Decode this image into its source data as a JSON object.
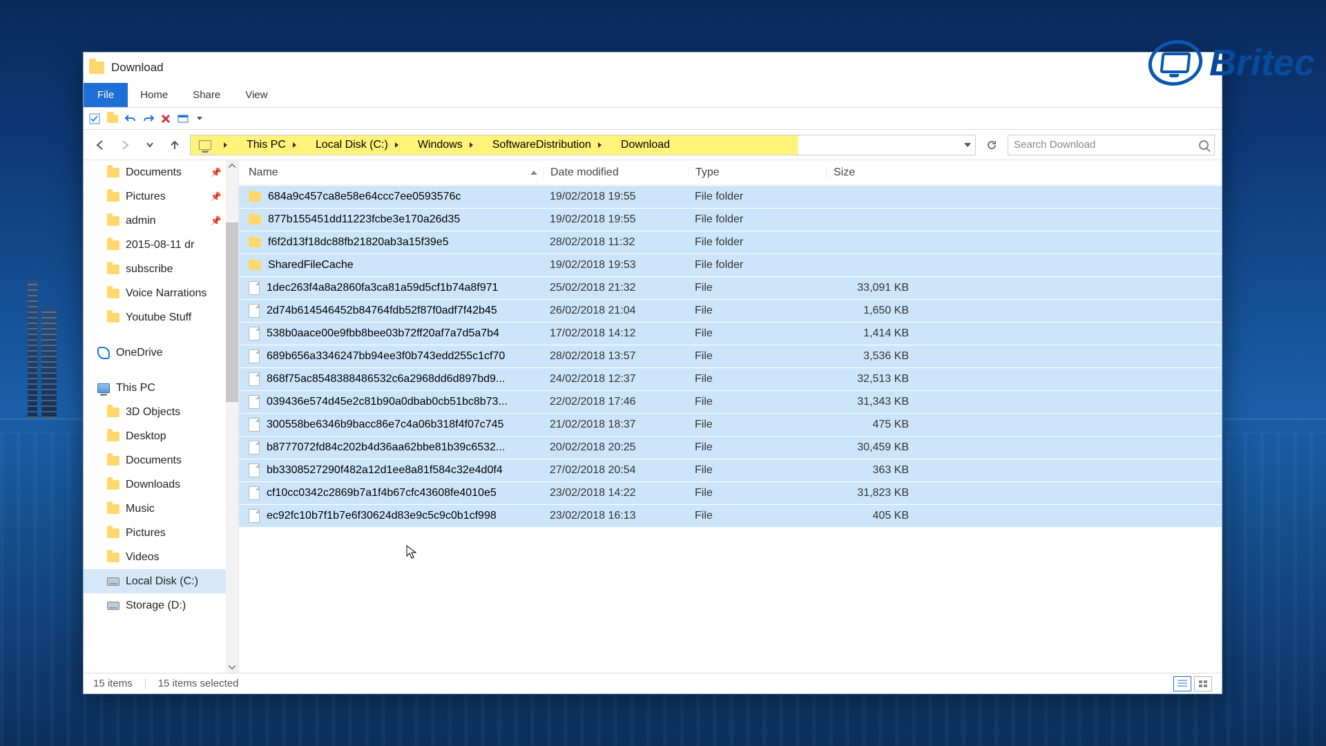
{
  "window": {
    "title": "Download"
  },
  "ribbon": {
    "file": "File",
    "home": "Home",
    "share": "Share",
    "view": "View"
  },
  "breadcrumb": {
    "root": "This PC",
    "segs": [
      "Local Disk (C:)",
      "Windows",
      "SoftwareDistribution",
      "Download"
    ]
  },
  "search": {
    "placeholder": "Search Download"
  },
  "columns": {
    "name": "Name",
    "date": "Date modified",
    "type": "Type",
    "size": "Size"
  },
  "nav": {
    "quick": [
      {
        "label": "Documents",
        "pinned": true
      },
      {
        "label": "Pictures",
        "pinned": true
      },
      {
        "label": "admin",
        "pinned": true
      },
      {
        "label": "2015-08-11 dr"
      },
      {
        "label": "subscribe"
      },
      {
        "label": "Voice Narrations"
      },
      {
        "label": "Youtube Stuff"
      }
    ],
    "onedrive": "OneDrive",
    "thispc": "This PC",
    "thispc_items": [
      {
        "label": "3D Objects",
        "kind": "fld"
      },
      {
        "label": "Desktop",
        "kind": "fld"
      },
      {
        "label": "Documents",
        "kind": "fld"
      },
      {
        "label": "Downloads",
        "kind": "fld"
      },
      {
        "label": "Music",
        "kind": "fld"
      },
      {
        "label": "Pictures",
        "kind": "fld"
      },
      {
        "label": "Videos",
        "kind": "fld"
      },
      {
        "label": "Local Disk (C:)",
        "kind": "drv"
      },
      {
        "label": "Storage (D:)",
        "kind": "drv"
      }
    ]
  },
  "files": [
    {
      "name": "684a9c457ca8e58e64ccc7ee0593576c",
      "date": "19/02/2018 19:55",
      "type": "File folder",
      "size": "",
      "kind": "folder"
    },
    {
      "name": "877b155451dd11223fcbe3e170a26d35",
      "date": "19/02/2018 19:55",
      "type": "File folder",
      "size": "",
      "kind": "folder"
    },
    {
      "name": "f6f2d13f18dc88fb21820ab3a15f39e5",
      "date": "28/02/2018 11:32",
      "type": "File folder",
      "size": "",
      "kind": "folder"
    },
    {
      "name": "SharedFileCache",
      "date": "19/02/2018 19:53",
      "type": "File folder",
      "size": "",
      "kind": "folder"
    },
    {
      "name": "1dec263f4a8a2860fa3ca81a59d5cf1b74a8f971",
      "date": "25/02/2018 21:32",
      "type": "File",
      "size": "33,091 KB",
      "kind": "file"
    },
    {
      "name": "2d74b614546452b84764fdb52f87f0adf7f42b45",
      "date": "26/02/2018 21:04",
      "type": "File",
      "size": "1,650 KB",
      "kind": "file"
    },
    {
      "name": "538b0aace00e9fbb8bee03b72ff20af7a7d5a7b4",
      "date": "17/02/2018 14:12",
      "type": "File",
      "size": "1,414 KB",
      "kind": "file"
    },
    {
      "name": "689b656a3346247bb94ee3f0b743edd255c1cf70",
      "date": "28/02/2018 13:57",
      "type": "File",
      "size": "3,536 KB",
      "kind": "file"
    },
    {
      "name": "868f75ac8548388486532c6a2968dd6d897bd9...",
      "date": "24/02/2018 12:37",
      "type": "File",
      "size": "32,513 KB",
      "kind": "file"
    },
    {
      "name": "039436e574d45e2c81b90a0dbab0cb51bc8b73...",
      "date": "22/02/2018 17:46",
      "type": "File",
      "size": "31,343 KB",
      "kind": "file"
    },
    {
      "name": "300558be6346b9bacc86e7c4a06b318f4f07c745",
      "date": "21/02/2018 18:37",
      "type": "File",
      "size": "475 KB",
      "kind": "file"
    },
    {
      "name": "b8777072fd84c202b4d36aa62bbe81b39c6532...",
      "date": "20/02/2018 20:25",
      "type": "File",
      "size": "30,459 KB",
      "kind": "file"
    },
    {
      "name": "bb3308527290f482a12d1ee8a81f584c32e4d0f4",
      "date": "27/02/2018 20:54",
      "type": "File",
      "size": "363 KB",
      "kind": "file"
    },
    {
      "name": "cf10cc0342c2869b7a1f4b67cfc43608fe4010e5",
      "date": "23/02/2018 14:22",
      "type": "File",
      "size": "31,823 KB",
      "kind": "file"
    },
    {
      "name": "ec92fc10b7f1b7e6f30624d83e9c5c9c0b1cf998",
      "date": "23/02/2018 16:13",
      "type": "File",
      "size": "405 KB",
      "kind": "file"
    }
  ],
  "status": {
    "items": "15 items",
    "selected": "15 items selected"
  },
  "brand": "Britec"
}
